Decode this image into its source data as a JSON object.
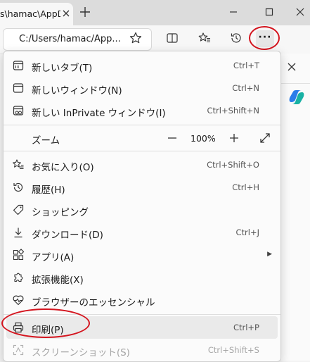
{
  "tab": {
    "title": "s\\hamac\\AppD",
    "close_icon": "close-icon"
  },
  "window": {
    "newtab_icon": "plus-icon",
    "minimize_icon": "minimize-icon",
    "maximize_icon": "maximize-icon",
    "close_icon": "close-icon"
  },
  "address": {
    "value": "C:/Users/hamac/App..."
  },
  "toolbar": {
    "favorite_icon": "star-icon",
    "splitscreen_icon": "split-screen-icon",
    "favorites_icon": "favorites-icon",
    "history_icon": "history-icon",
    "more_label": "···"
  },
  "menu": {
    "items": [
      {
        "label": "新しいタブ(T)",
        "shortcut": "Ctrl+T",
        "icon": "new-tab-icon"
      },
      {
        "label": "新しいウィンドウ(N)",
        "shortcut": "Ctrl+N",
        "icon": "new-window-icon"
      },
      {
        "label": "新しい InPrivate ウィンドウ(I)",
        "shortcut": "Ctrl+Shift+N",
        "icon": "inprivate-icon"
      },
      {
        "label": "お気に入り(O)",
        "shortcut": "Ctrl+Shift+O",
        "icon": "favorites-icon"
      },
      {
        "label": "履歴(H)",
        "shortcut": "Ctrl+H",
        "icon": "history-icon"
      },
      {
        "label": "ショッピング",
        "shortcut": "",
        "icon": "shopping-tag-icon"
      },
      {
        "label": "ダウンロード(D)",
        "shortcut": "Ctrl+J",
        "icon": "download-icon"
      },
      {
        "label": "アプリ(A)",
        "shortcut": "",
        "icon": "apps-icon",
        "submenu": true
      },
      {
        "label": "拡張機能(X)",
        "shortcut": "",
        "icon": "extensions-icon"
      },
      {
        "label": "ブラウザーのエッセンシャル",
        "shortcut": "",
        "icon": "heart-pulse-icon"
      },
      {
        "label": "印刷(P)",
        "shortcut": "Ctrl+P",
        "icon": "print-icon",
        "highlighted": true
      },
      {
        "label": "スクリーンショット(S)",
        "shortcut": "Ctrl+Shift+S",
        "icon": "screenshot-icon",
        "disabled": true
      }
    ],
    "zoom": {
      "label": "ズーム",
      "value": "100%",
      "minus_icon": "minus-icon",
      "plus_icon": "plus-icon",
      "fullscreen_icon": "fullscreen-icon"
    }
  },
  "annotations": {
    "accent": "#d4141e"
  }
}
